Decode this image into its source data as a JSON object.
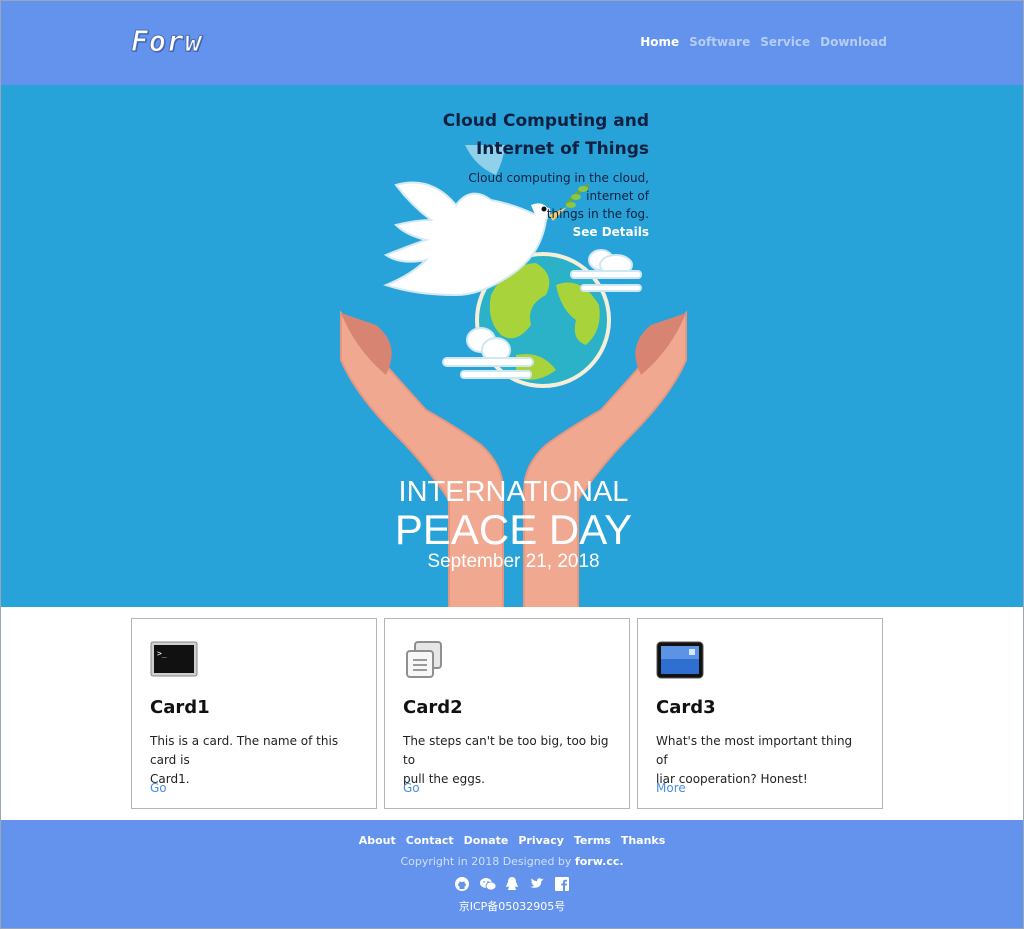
{
  "header": {
    "logo": "Forw",
    "nav": [
      "Home",
      "Software",
      "Service",
      "Download"
    ]
  },
  "hero": {
    "title_line1": "Cloud Computing and",
    "title_line2": "Internet of Things",
    "desc_line1": "Cloud computing in the cloud, internet of",
    "desc_line2": "things in the fog.",
    "link": "See Details",
    "poster_line1": "INTERNATIONAL",
    "poster_line2": "PEACE DAY",
    "poster_line3": "September 21, 2018"
  },
  "cards": [
    {
      "icon": "terminal-icon",
      "title": "Card1",
      "text_line1": "This is a card. The name of this card is",
      "text_line2": "Card1.",
      "link": "Go"
    },
    {
      "icon": "documents-icon",
      "title": "Card2",
      "text_line1": "The steps can't be too big, too big to",
      "text_line2": "pull the eggs.",
      "link": "Go"
    },
    {
      "icon": "tablet-icon",
      "title": "Card3",
      "text_line1": "What's the most important thing of",
      "text_line2": "liar cooperation? Honest!",
      "link": "More"
    }
  ],
  "footer": {
    "links": [
      "About",
      "Contact",
      "Donate",
      "Privacy",
      "Terms",
      "Thanks"
    ],
    "copyright_prefix": "Copyright in 2018 Designed by",
    "copyright_site": "forw.cc.",
    "social": [
      "github-icon",
      "wechat-icon",
      "qq-icon",
      "twitter-icon",
      "facebook-icon"
    ],
    "icp": "京ICP备05032905号"
  },
  "colors": {
    "header_bg": "#6393ed",
    "hero_bg": "#27a3d9",
    "link": "#4b8ee0"
  }
}
